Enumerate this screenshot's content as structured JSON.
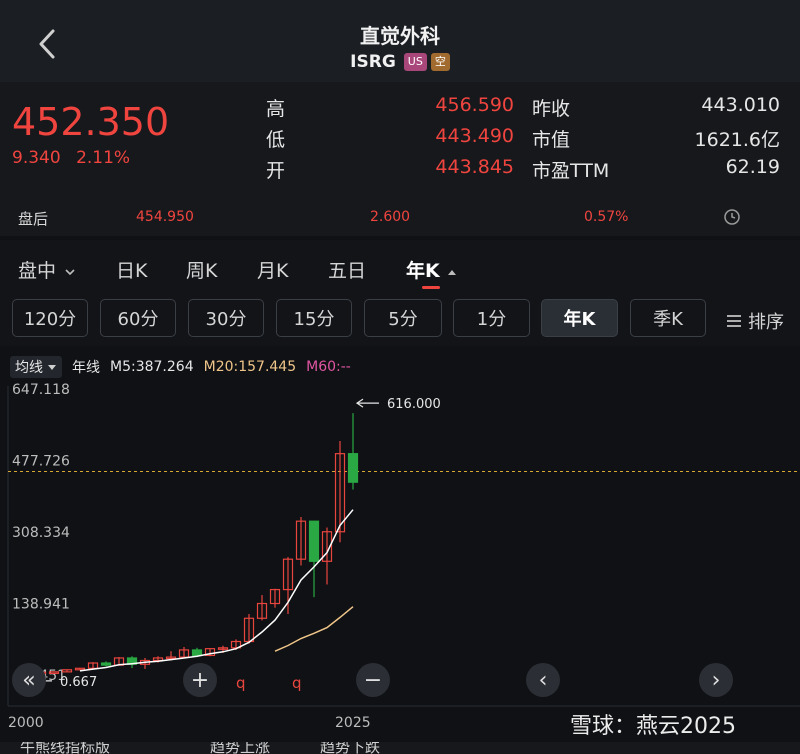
{
  "header": {
    "stock_name": "直觉外科",
    "ticker": "ISRG",
    "badge_us": "US",
    "badge_short": "空"
  },
  "quote": {
    "price": "452.350",
    "change": "9.340",
    "change_pct": "2.11%",
    "high_label": "高",
    "high": "456.590",
    "low_label": "低",
    "low": "443.490",
    "open_label": "开",
    "open": "443.845",
    "prev_close_label": "昨收",
    "prev_close": "443.010",
    "mkt_cap_label": "市值",
    "mkt_cap": "1621.6亿",
    "pe_label": "市盈TTM",
    "pe": "62.19"
  },
  "after_hours": {
    "label": "盘后",
    "price": "454.950",
    "change": "2.600",
    "pct": "0.57%"
  },
  "tabs": [
    {
      "label": "盘中"
    },
    {
      "label": "日K"
    },
    {
      "label": "周K"
    },
    {
      "label": "月K"
    },
    {
      "label": "五日"
    },
    {
      "label": "年K"
    }
  ],
  "intervals": [
    {
      "label": "120分"
    },
    {
      "label": "60分"
    },
    {
      "label": "30分"
    },
    {
      "label": "15分"
    },
    {
      "label": "5分"
    },
    {
      "label": "1分"
    },
    {
      "label": "年K"
    },
    {
      "label": "季K"
    }
  ],
  "sort_label": "排序",
  "legend": {
    "ma_select": "均线",
    "period": "年线",
    "m5": "M5:387.264",
    "m20": "M20:157.445",
    "m60": "M60:--"
  },
  "chart_data": {
    "type": "candlestick",
    "title": "",
    "y_ticks": [
      "647.118",
      "477.726",
      "308.334",
      "138.941",
      "-30.451"
    ],
    "x_ticks": [
      "2000",
      "2025"
    ],
    "ylim": [
      -30.451,
      647.118
    ],
    "current_price_line": 477.726,
    "max_annotation": "616.000",
    "min_annotation": "0.667",
    "colors": {
      "up": "#e8453f",
      "down": "#2aa844",
      "ma5": "#ffffff",
      "ma20": "#f0c58a"
    },
    "candles": [
      {
        "year": 2000,
        "open": 0.9,
        "high": 4.0,
        "low": 0.667,
        "close": 1.6
      },
      {
        "year": 2001,
        "open": 1.6,
        "high": 3.0,
        "low": 0.9,
        "close": 2.2
      },
      {
        "year": 2002,
        "open": 2.2,
        "high": 3.5,
        "low": 1.5,
        "close": 3.0
      },
      {
        "year": 2003,
        "open": 3.0,
        "high": 9.0,
        "low": 2.6,
        "close": 8.0
      },
      {
        "year": 2004,
        "open": 8.0,
        "high": 12.0,
        "low": 6.5,
        "close": 11.5
      },
      {
        "year": 2005,
        "open": 11.5,
        "high": 26.0,
        "low": 9.0,
        "close": 24.0
      },
      {
        "year": 2006,
        "open": 24.0,
        "high": 28.0,
        "low": 16.0,
        "close": 19.0
      },
      {
        "year": 2007,
        "open": 19.0,
        "high": 38.0,
        "low": 18.0,
        "close": 36.0
      },
      {
        "year": 2008,
        "open": 36.0,
        "high": 40.0,
        "low": 12.0,
        "close": 21.0
      },
      {
        "year": 2009,
        "open": 21.0,
        "high": 36.0,
        "low": 10.0,
        "close": 30.0
      },
      {
        "year": 2010,
        "open": 30.0,
        "high": 40.0,
        "low": 25.0,
        "close": 36.0
      },
      {
        "year": 2011,
        "open": 36.0,
        "high": 52.0,
        "low": 30.0,
        "close": 38.0
      },
      {
        "year": 2012,
        "open": 38.0,
        "high": 62.0,
        "low": 36.0,
        "close": 55.0
      },
      {
        "year": 2013,
        "open": 55.0,
        "high": 60.0,
        "low": 38.0,
        "close": 42.0
      },
      {
        "year": 2014,
        "open": 42.0,
        "high": 58.0,
        "low": 40.0,
        "close": 58.0
      },
      {
        "year": 2015,
        "open": 58.0,
        "high": 65.0,
        "low": 48.0,
        "close": 60.0
      },
      {
        "year": 2016,
        "open": 60.0,
        "high": 80.0,
        "low": 55.0,
        "close": 75.0
      },
      {
        "year": 2017,
        "open": 75.0,
        "high": 140.0,
        "low": 70.0,
        "close": 130.0
      },
      {
        "year": 2018,
        "open": 130.0,
        "high": 185.0,
        "low": 125.0,
        "close": 165.0
      },
      {
        "year": 2019,
        "open": 165.0,
        "high": 200.0,
        "low": 155.0,
        "close": 198.0
      },
      {
        "year": 2020,
        "open": 198.0,
        "high": 275.0,
        "low": 140.0,
        "close": 270.0
      },
      {
        "year": 2021,
        "open": 270.0,
        "high": 370.0,
        "low": 255.0,
        "close": 360.0
      },
      {
        "year": 2022,
        "open": 360.0,
        "high": 360.0,
        "low": 180.0,
        "close": 265.0
      },
      {
        "year": 2023,
        "open": 265.0,
        "high": 345.0,
        "low": 210.0,
        "close": 335.0
      },
      {
        "year": 2024,
        "open": 335.0,
        "high": 550.0,
        "low": 310.0,
        "close": 520.0
      },
      {
        "year": 2025,
        "open": 520.0,
        "high": 616.0,
        "low": 435.0,
        "close": 452.35
      }
    ],
    "ma5": [
      null,
      null,
      null,
      null,
      5.3,
      9.7,
      13.3,
      19.7,
      22.3,
      26.0,
      28.4,
      32.2,
      36.0,
      40.2,
      45.8,
      50.6,
      58.0,
      73.0,
      97.6,
      125.6,
      167.6,
      220.6,
      251.6,
      285.6,
      350.0,
      387.264
    ],
    "ma20": [
      null,
      null,
      null,
      null,
      null,
      null,
      null,
      null,
      null,
      null,
      null,
      null,
      null,
      null,
      null,
      null,
      null,
      null,
      null,
      52.0,
      65.4,
      82.0,
      94.3,
      108.0,
      132.0,
      157.445
    ]
  },
  "chart_controls": {
    "collapse": "«",
    "zoom_in": "+",
    "zoom_out": "−",
    "prev": "‹",
    "next": "›",
    "marker1": "q",
    "marker2": "q"
  },
  "watermark": "雪球：燕云2025",
  "footer": {
    "left": "牛熊线指标版",
    "mid": "趋势上涨",
    "right": "趋势下跌"
  }
}
